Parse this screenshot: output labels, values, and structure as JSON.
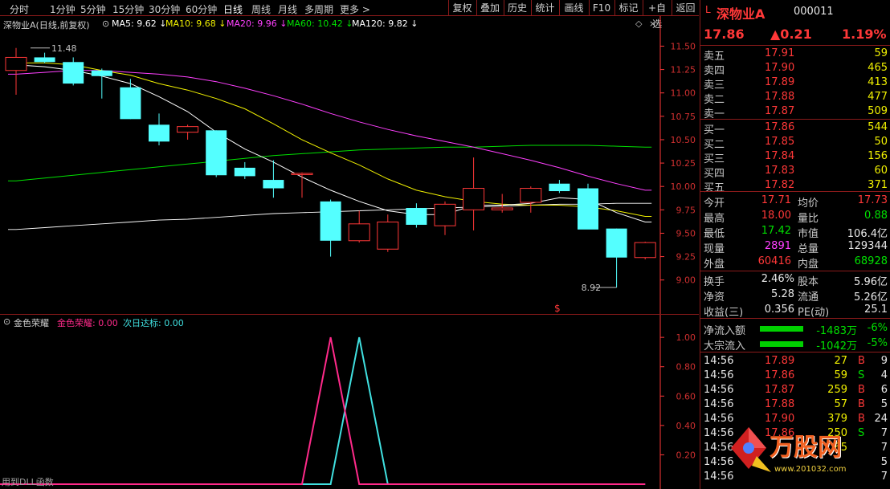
{
  "toolbar": {
    "periods": [
      "分时",
      "1分钟",
      "5分钟",
      "15分钟",
      "30分钟",
      "60分钟",
      "日线",
      "周线",
      "月线",
      "多周期",
      "更多 >"
    ],
    "active_period": "日线",
    "tools": [
      "复权",
      "叠加",
      "历史",
      "统计",
      "画线",
      "F10",
      "标记",
      "+自选",
      "返回"
    ]
  },
  "main": {
    "title": "深物业A(日线,前复权)",
    "ma": [
      {
        "label": "MA5: 9.62",
        "color": "#ffffff"
      },
      {
        "label": "MA10: 9.68",
        "color": "#f0f000"
      },
      {
        "label": "MA20: 9.96",
        "color": "#ff40ff"
      },
      {
        "label": "MA60: 10.42",
        "color": "#00e000"
      },
      {
        "label": "MA120: 9.82",
        "color": "#ffffff"
      }
    ],
    "arrow": "↓",
    "high_label": "11.48",
    "low_label": "8.92",
    "marker": "$",
    "colors": {
      "up": "#ff3838",
      "down": "#54ffff",
      "ma5": "#ffffff",
      "ma10": "#f0f000",
      "ma20": "#ff40ff",
      "ma60": "#00e000",
      "ma120": "#ffffff",
      "axis": "#ff3838"
    }
  },
  "chart_data": {
    "type": "candlestick",
    "ylim": [
      8.8,
      11.65
    ],
    "y_ticks": [
      "11.50",
      "11.25",
      "11.00",
      "10.75",
      "10.50",
      "10.25",
      "10.00",
      "9.75",
      "9.50",
      "9.25",
      "9.00"
    ],
    "candles": [
      {
        "o": 11.24,
        "h": 11.48,
        "l": 10.98,
        "c": 11.38
      },
      {
        "o": 11.38,
        "h": 11.43,
        "l": 11.32,
        "c": 11.33
      },
      {
        "o": 11.33,
        "h": 11.38,
        "l": 11.08,
        "c": 11.1
      },
      {
        "o": 11.24,
        "h": 11.26,
        "l": 10.94,
        "c": 11.18
      },
      {
        "o": 11.06,
        "h": 11.15,
        "l": 10.72,
        "c": 10.72
      },
      {
        "o": 10.66,
        "h": 10.78,
        "l": 10.44,
        "c": 10.48
      },
      {
        "o": 10.58,
        "h": 10.66,
        "l": 10.5,
        "c": 10.64
      },
      {
        "o": 10.6,
        "h": 10.6,
        "l": 10.1,
        "c": 10.12
      },
      {
        "o": 10.2,
        "h": 10.26,
        "l": 10.08,
        "c": 10.11
      },
      {
        "o": 10.07,
        "h": 10.28,
        "l": 9.88,
        "c": 9.98
      },
      {
        "o": 10.14,
        "h": 10.15,
        "l": 9.88,
        "c": 10.14
      },
      {
        "o": 9.84,
        "h": 9.86,
        "l": 9.25,
        "c": 9.42
      },
      {
        "o": 9.42,
        "h": 9.74,
        "l": 9.4,
        "c": 9.6
      },
      {
        "o": 9.33,
        "h": 9.7,
        "l": 9.3,
        "c": 9.62
      },
      {
        "o": 9.77,
        "h": 9.82,
        "l": 9.56,
        "c": 9.59
      },
      {
        "o": 9.58,
        "h": 9.84,
        "l": 9.48,
        "c": 9.81
      },
      {
        "o": 9.75,
        "h": 10.31,
        "l": 9.53,
        "c": 9.98
      },
      {
        "o": 9.75,
        "h": 9.92,
        "l": 9.72,
        "c": 9.77
      },
      {
        "o": 9.83,
        "h": 10.0,
        "l": 9.72,
        "c": 9.98
      },
      {
        "o": 10.03,
        "h": 10.07,
        "l": 9.93,
        "c": 9.95
      },
      {
        "o": 9.98,
        "h": 10.03,
        "l": 9.58,
        "c": 9.54
      },
      {
        "o": 9.55,
        "h": 9.55,
        "l": 8.92,
        "c": 9.24
      },
      {
        "o": 9.24,
        "h": 9.41,
        "l": 9.22,
        "c": 9.4
      }
    ],
    "ma5": [
      11.3,
      11.28,
      11.24,
      11.18,
      11.1,
      10.96,
      10.8,
      10.58,
      10.4,
      10.26,
      10.1,
      9.96,
      9.84,
      9.74,
      9.7,
      9.7,
      9.8,
      9.8,
      9.82,
      9.88,
      9.86,
      9.72,
      9.62
    ],
    "ma10": [
      11.32,
      11.32,
      11.3,
      11.24,
      11.19,
      11.1,
      11.03,
      10.94,
      10.83,
      10.67,
      10.5,
      10.36,
      10.23,
      10.08,
      9.96,
      9.89,
      9.84,
      9.81,
      9.8,
      9.8,
      9.78,
      9.74,
      9.68
    ],
    "ma20": [
      11.2,
      11.22,
      11.24,
      11.24,
      11.22,
      11.2,
      11.17,
      11.12,
      11.05,
      10.97,
      10.88,
      10.78,
      10.69,
      10.61,
      10.54,
      10.48,
      10.42,
      10.35,
      10.28,
      10.2,
      10.11,
      10.03,
      9.96
    ],
    "ma60": [
      10.06,
      10.09,
      10.12,
      10.15,
      10.18,
      10.21,
      10.24,
      10.27,
      10.3,
      10.33,
      10.35,
      10.37,
      10.39,
      10.4,
      10.41,
      10.42,
      10.42,
      10.43,
      10.44,
      10.44,
      10.44,
      10.43,
      10.42
    ],
    "ma120": [
      9.54,
      9.56,
      9.58,
      9.6,
      9.62,
      9.64,
      9.65,
      9.67,
      9.69,
      9.71,
      9.72,
      9.73,
      9.74,
      9.75,
      9.76,
      9.77,
      9.78,
      9.79,
      9.8,
      9.81,
      9.81,
      9.82,
      9.82
    ]
  },
  "indicator": {
    "title": "金色荣耀",
    "legend_gold": "金色荣耀: 0.00",
    "legend_next": "次日达标: 0.00",
    "ylim": [
      0,
      1.05
    ],
    "y_ticks": [
      "1.00",
      "0.80",
      "0.60",
      "0.40",
      "0.20"
    ],
    "footer": "用到DLL函数",
    "gold_values": [
      0,
      0,
      0,
      0,
      0,
      0,
      0,
      0,
      0,
      0,
      0,
      1,
      0,
      0,
      0,
      0,
      0,
      0,
      0,
      0,
      0,
      0,
      0
    ],
    "next_values": [
      0,
      0,
      0,
      0,
      0,
      0,
      0,
      0,
      0,
      0,
      0,
      0,
      1,
      0,
      0,
      0,
      0,
      0,
      0,
      0,
      0,
      0,
      0
    ]
  },
  "quote": {
    "prefix": "L",
    "name": "深物业A",
    "code": "000011",
    "price": "17.86",
    "change": "▲0.21",
    "pct": "1.19%",
    "asks": [
      {
        "label": "卖五",
        "price": "17.91",
        "vol": "59"
      },
      {
        "label": "卖四",
        "price": "17.90",
        "vol": "465"
      },
      {
        "label": "卖三",
        "price": "17.89",
        "vol": "413"
      },
      {
        "label": "卖二",
        "price": "17.88",
        "vol": "477"
      },
      {
        "label": "卖一",
        "price": "17.87",
        "vol": "509"
      }
    ],
    "bids": [
      {
        "label": "买一",
        "price": "17.86",
        "vol": "544"
      },
      {
        "label": "买二",
        "price": "17.85",
        "vol": "50"
      },
      {
        "label": "买三",
        "price": "17.84",
        "vol": "156"
      },
      {
        "label": "买四",
        "price": "17.83",
        "vol": "60"
      },
      {
        "label": "买五",
        "price": "17.82",
        "vol": "371"
      }
    ],
    "stats": [
      {
        "l1": "今开",
        "v1": "17.71",
        "c1": "red",
        "l2": "均价",
        "v2": "17.73",
        "c2": "red"
      },
      {
        "l1": "最高",
        "v1": "18.00",
        "c1": "red",
        "l2": "量比",
        "v2": "0.88",
        "c2": "green"
      },
      {
        "l1": "最低",
        "v1": "17.42",
        "c1": "green",
        "l2": "市值",
        "v2": "106.4亿",
        "c2": "white"
      },
      {
        "l1": "现量",
        "v1": "2891",
        "c1": "magenta",
        "l2": "总量",
        "v2": "129344",
        "c2": "white"
      },
      {
        "l1": "外盘",
        "v1": "60416",
        "c1": "red",
        "l2": "内盘",
        "v2": "68928",
        "c2": "green"
      }
    ],
    "fin": [
      {
        "l1": "换手",
        "v1": "2.46%",
        "l2": "股本",
        "v2": "5.96亿"
      },
      {
        "l1": "净资",
        "v1": "5.28",
        "l2": "流通",
        "v2": "5.26亿"
      },
      {
        "l1": "收益(三)",
        "v1": "0.356",
        "l2": "PE(动)",
        "v2": "25.1"
      }
    ],
    "flows": [
      {
        "label": "净流入额",
        "value": "-1483万",
        "pct": "-6%"
      },
      {
        "label": "大宗流入",
        "value": "-1042万",
        "pct": "-5%"
      }
    ],
    "ticks": [
      {
        "time": "14:56",
        "price": "17.89",
        "vol": "27",
        "side": "B",
        "n": "9"
      },
      {
        "time": "14:56",
        "price": "17.86",
        "vol": "59",
        "side": "S",
        "n": "4"
      },
      {
        "time": "14:56",
        "price": "17.87",
        "vol": "259",
        "side": "B",
        "n": "6"
      },
      {
        "time": "14:56",
        "price": "17.88",
        "vol": "57",
        "side": "B",
        "n": "5"
      },
      {
        "time": "14:56",
        "price": "17.90",
        "vol": "379",
        "side": "B",
        "n": "24"
      },
      {
        "time": "14:56",
        "price": "17.86",
        "vol": "250",
        "side": "S",
        "n": "7"
      },
      {
        "time": "14:56",
        "price": "",
        "vol": "65",
        "side": "",
        "n": "7"
      },
      {
        "time": "14:56",
        "price": "",
        "vol": "",
        "side": "",
        "n": "5"
      },
      {
        "time": "14:56",
        "price": "",
        "vol": "",
        "side": "",
        "n": "7"
      }
    ],
    "watermark": {
      "brand": "万股网",
      "url": "www.201032.com"
    }
  }
}
